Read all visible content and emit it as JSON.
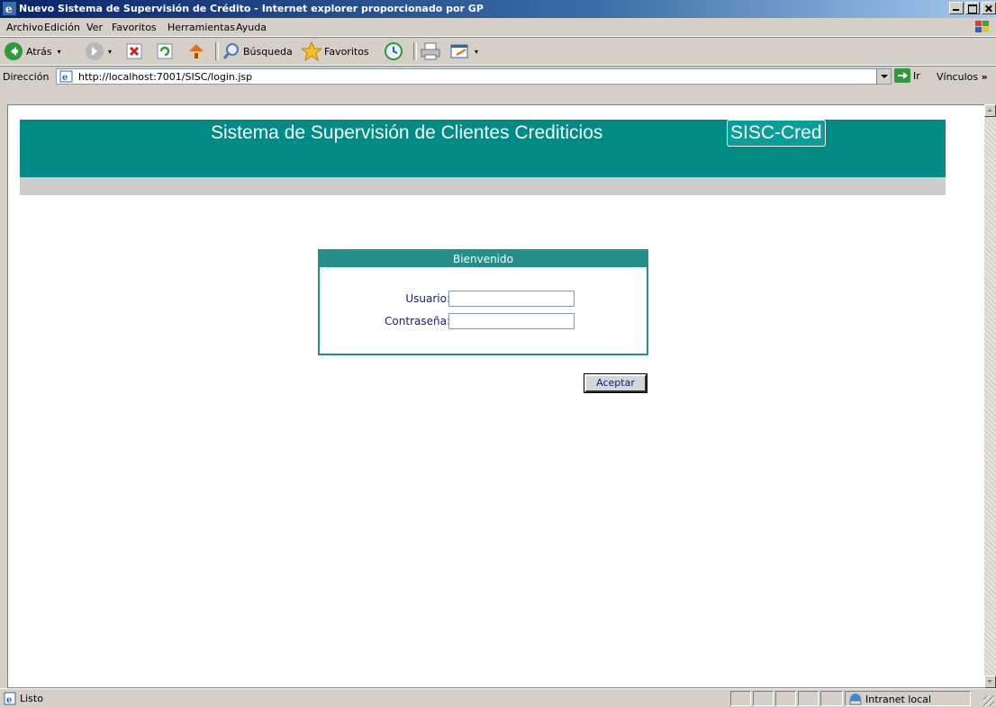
{
  "window": {
    "title": "Nuevo Sistema de Supervisión de Crédito - Internet explorer proporcionado por GP"
  },
  "menu": {
    "items": [
      "Archivo",
      "Edición",
      "Ver",
      "Favoritos",
      "Herramientas",
      "Ayuda"
    ]
  },
  "toolbar": {
    "back_label": "Atrás",
    "search_label": "Búsqueda",
    "favorites_label": "Favoritos"
  },
  "address": {
    "label": "Dirección",
    "url": "http://localhost:7001/SISC/login.jsp",
    "go_label": "Ir",
    "links_label": "Vínculos"
  },
  "page": {
    "header_title": "Sistema de Supervisión de Clientes Crediticios",
    "header_badge": "SISC-Cred",
    "login_title": "Bienvenido",
    "user_label": "Usuario:",
    "user_value": "",
    "password_label": "Contraseña:",
    "password_value": "",
    "accept_label": "Aceptar"
  },
  "status": {
    "text": "Listo",
    "zone": "Intranet local"
  },
  "colors": {
    "banner": "#008b85",
    "login_header": "#238f88",
    "strip": "#cccccc"
  }
}
